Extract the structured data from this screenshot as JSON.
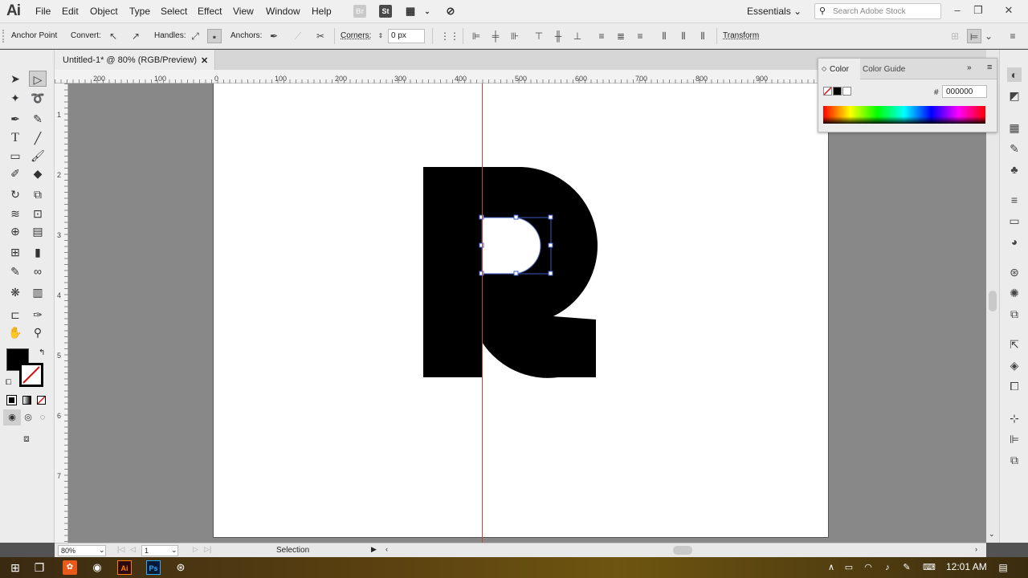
{
  "app": {
    "logo": "Ai",
    "menus": [
      "File",
      "Edit",
      "Object",
      "Type",
      "Select",
      "Effect",
      "View",
      "Window",
      "Help"
    ],
    "bridge_label": "Br",
    "stock_label": "St",
    "workspace": "Essentials",
    "search_placeholder": "Search Adobe Stock"
  },
  "control_bar": {
    "tool_name": "Anchor Point",
    "convert_label": "Convert:",
    "handles_label": "Handles:",
    "anchors_label": "Anchors:",
    "corners_label": "Corners:",
    "corners_value": "0 px",
    "transform_label": "Transform"
  },
  "document": {
    "tab_title": "Untitled-1* @ 80% (RGB/Preview)",
    "close": "✕"
  },
  "rulers": {
    "horizontal": [
      "200",
      "100",
      "0",
      "100",
      "200",
      "300",
      "400",
      "500",
      "600",
      "700",
      "800",
      "900"
    ],
    "vertical": [
      "1",
      "2",
      "3",
      "4",
      "5",
      "6",
      "7"
    ]
  },
  "color_panel": {
    "tab_color": "Color",
    "tab_guide": "Color Guide",
    "hash": "#",
    "hex": "000000"
  },
  "status_bar": {
    "zoom": "80%",
    "page": "1",
    "status": "Selection"
  },
  "taskbar": {
    "time": "12:01 AM"
  },
  "colors": {
    "fill": "#000000",
    "artboard": "#ffffff",
    "guide": "#c0473d",
    "selection": "#3d5cc4"
  }
}
